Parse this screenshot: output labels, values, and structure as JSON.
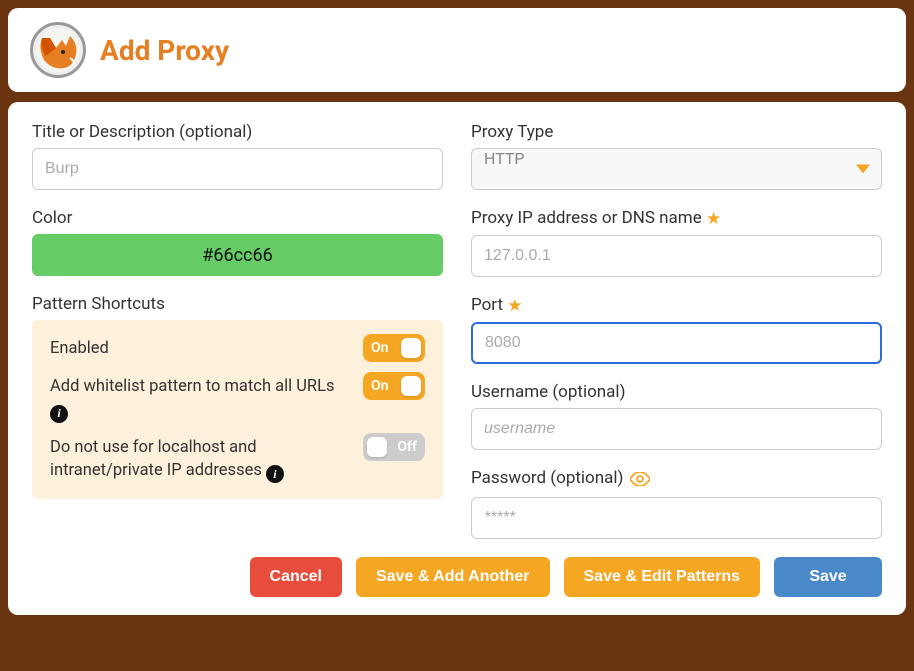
{
  "header": {
    "title": "Add Proxy"
  },
  "leftCol": {
    "title": {
      "label": "Title or Description (optional)",
      "placeholder": "Burp",
      "value": ""
    },
    "color": {
      "label": "Color",
      "value": "#66cc66"
    },
    "shortcutsLabel": "Pattern Shortcuts",
    "shortcuts": {
      "enabled": {
        "label": "Enabled",
        "state": "On"
      },
      "whitelist": {
        "label": "Add whitelist pattern to match all URLs",
        "state": "On"
      },
      "noLocalhost": {
        "label": "Do not use for localhost and intranet/private IP addresses",
        "state": "Off"
      }
    }
  },
  "rightCol": {
    "proxyType": {
      "label": "Proxy Type",
      "value": "HTTP"
    },
    "ip": {
      "label": "Proxy IP address or DNS name",
      "placeholder": "127.0.0.1",
      "value": ""
    },
    "port": {
      "label": "Port",
      "placeholder": "8080",
      "value": ""
    },
    "username": {
      "label": "Username (optional)",
      "placeholder": "username",
      "value": ""
    },
    "password": {
      "label": "Password (optional)",
      "placeholder": "*****",
      "value": ""
    }
  },
  "buttons": {
    "cancel": "Cancel",
    "saveAnother": "Save & Add Another",
    "savePatterns": "Save & Edit Patterns",
    "save": "Save"
  }
}
